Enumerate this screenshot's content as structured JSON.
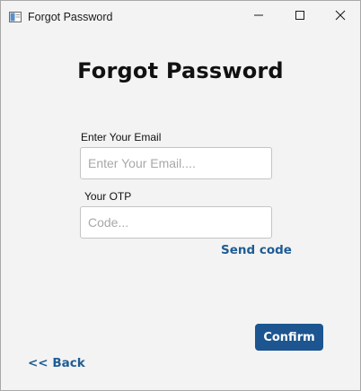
{
  "window": {
    "title": "Forgot Password",
    "app_icon": "window-app-icon",
    "controls": {
      "minimize_icon": "minimize-icon",
      "maximize_icon": "maximize-icon",
      "close_icon": "close-icon"
    }
  },
  "form": {
    "heading": "Forgot Password",
    "email": {
      "label": "Enter Your Email",
      "value": "",
      "placeholder": "Enter Your Email...."
    },
    "otp": {
      "label": "Your OTP",
      "value": "",
      "placeholder": "Code..."
    },
    "send_code_label": "Send code",
    "confirm_label": "Confirm",
    "back_label": "<< Back"
  },
  "colors": {
    "accent": "#1c5590",
    "link": "#1f5c94",
    "background": "#f3f3f3"
  }
}
